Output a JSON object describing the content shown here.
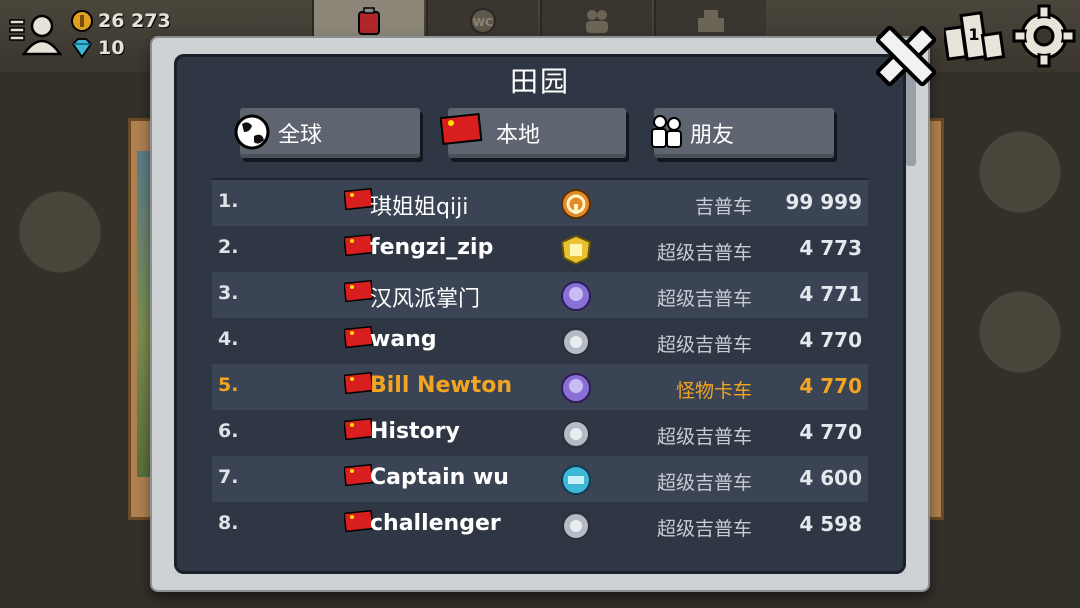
{
  "hud": {
    "coins": "26 273",
    "gems": "10"
  },
  "modal": {
    "title": "田园"
  },
  "scope_tabs": [
    {
      "label": "全球",
      "icon": "globe-icon"
    },
    {
      "label": "本地",
      "icon": "china-flag-icon"
    },
    {
      "label": "朋友",
      "icon": "friends-icon"
    }
  ],
  "leaderboard": {
    "rows": [
      {
        "rank": "1.",
        "name": "琪姐姐qiji",
        "vehicle": "吉普车",
        "score": "99 999",
        "badge": "steering-wheel-badge-icon"
      },
      {
        "rank": "2.",
        "name": "fengzi_zip",
        "vehicle": "超级吉普车",
        "score": "4 773",
        "badge": "gold-badge-icon"
      },
      {
        "rank": "3.",
        "name": "汉风派掌门",
        "vehicle": "超级吉普车",
        "score": "4 771",
        "badge": "purple-badge-icon"
      },
      {
        "rank": "4.",
        "name": "wang",
        "vehicle": "超级吉普车",
        "score": "4 770",
        "badge": "silver-badge-icon"
      },
      {
        "rank": "5.",
        "name": "Bill Newton",
        "vehicle": "怪物卡车",
        "score": "4 770",
        "badge": "purple-badge-icon",
        "highlight": true
      },
      {
        "rank": "6.",
        "name": "History",
        "vehicle": "超级吉普车",
        "score": "4 770",
        "badge": "silver-badge-icon"
      },
      {
        "rank": "7.",
        "name": "Captain wu",
        "vehicle": "超级吉普车",
        "score": "4 600",
        "badge": "blue-badge-icon"
      },
      {
        "rank": "8.",
        "name": "challenger",
        "vehicle": "超级吉普车",
        "score": "4 598",
        "badge": "silver-badge-icon"
      }
    ]
  },
  "colors": {
    "highlight": "#f3a521",
    "row_alt": "#3b4454",
    "panel": "#2f3744"
  }
}
